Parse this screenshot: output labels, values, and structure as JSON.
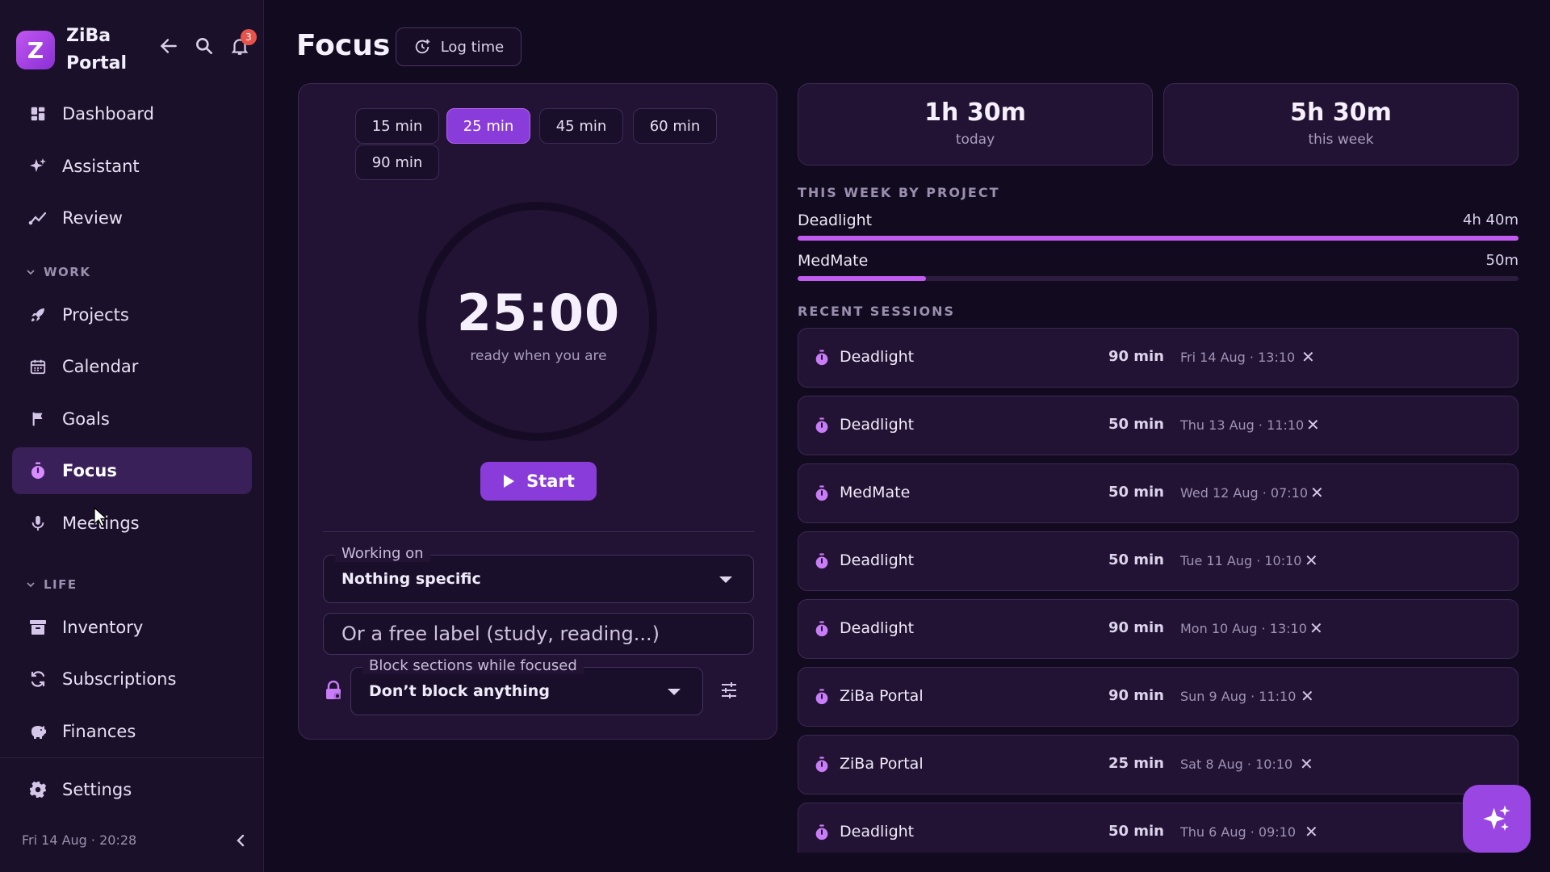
{
  "brand": {
    "initial": "Z",
    "name": "ZiBa Portal"
  },
  "notifications": {
    "count": "3"
  },
  "nav": {
    "dashboard": "Dashboard",
    "assistant": "Assistant",
    "review": "Review",
    "work_section": "WORK",
    "projects": "Projects",
    "calendar": "Calendar",
    "goals": "Goals",
    "focus": "Focus",
    "meetings": "Meetings",
    "life_section": "LIFE",
    "inventory": "Inventory",
    "subscriptions": "Subscriptions",
    "finances": "Finances",
    "settings": "Settings"
  },
  "footer": {
    "datetime": "Fri 14 Aug · 20:28"
  },
  "header": {
    "title": "Focus",
    "log_time": "Log time"
  },
  "timer": {
    "durations": [
      "15 min",
      "25 min",
      "45 min",
      "60 min",
      "90 min"
    ],
    "selected": "25 min",
    "display": "25:00",
    "subtitle": "ready when you are",
    "start": "Start",
    "working_on_label": "Working on",
    "working_on_value": "Nothing specific",
    "free_label_placeholder": "Or a free label (study, reading...)",
    "block_label": "Block sections while focused",
    "block_value": "Don’t block anything"
  },
  "stats": {
    "today_value": "1h 30m",
    "today_label": "today",
    "week_value": "5h 30m",
    "week_label": "this week"
  },
  "projects_heading": "THIS WEEK BY PROJECT",
  "projects": [
    {
      "name": "Deadlight",
      "value": "4h 40m",
      "fraction": 1.0
    },
    {
      "name": "MedMate",
      "value": "50m",
      "fraction": 0.178
    }
  ],
  "sessions_heading": "RECENT SESSIONS",
  "sessions": [
    {
      "name": "Deadlight",
      "duration": "90 min",
      "date": "Fri 14 Aug · 13:10"
    },
    {
      "name": "Deadlight",
      "duration": "50 min",
      "date": "Thu 13 Aug · 11:10"
    },
    {
      "name": "MedMate",
      "duration": "50 min",
      "date": "Wed 12 Aug · 07:10"
    },
    {
      "name": "Deadlight",
      "duration": "50 min",
      "date": "Tue 11 Aug · 10:10"
    },
    {
      "name": "Deadlight",
      "duration": "90 min",
      "date": "Mon 10 Aug · 13:10"
    },
    {
      "name": "ZiBa Portal",
      "duration": "90 min",
      "date": "Sun 9 Aug · 11:10"
    },
    {
      "name": "ZiBa Portal",
      "duration": "25 min",
      "date": "Sat 8 Aug · 10:10"
    },
    {
      "name": "Deadlight",
      "duration": "50 min",
      "date": "Thu 6 Aug · 09:10"
    }
  ],
  "colors": {
    "accent": "#8a3cdb",
    "accent_light": "#c25cf0",
    "background": "#120a1f",
    "panel": "#221334"
  }
}
